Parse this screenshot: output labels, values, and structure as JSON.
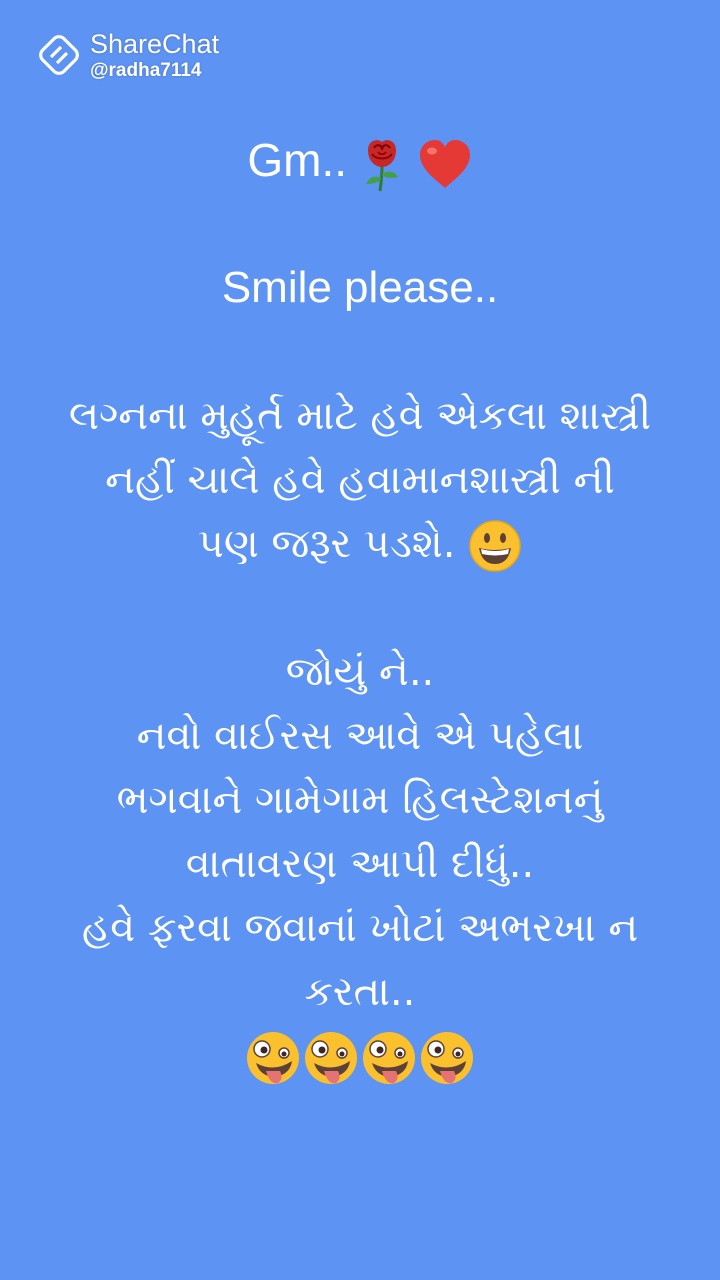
{
  "watermark": {
    "brand": "ShareChat",
    "handle": "@radha7114"
  },
  "post": {
    "greeting": "Gm..",
    "greeting_icons": [
      "rose-icon",
      "heart-icon"
    ],
    "smile": "Smile please..",
    "para1": [
      "લગ્નના મુહૂર્ત માટે હવે એકલા શાસ્ત્રી",
      "નહીં ચાલે હવે હવામાનશાસ્ત્રી ની",
      "પણ જરૂર પડશે."
    ],
    "para1_icon": "grinning-face-icon",
    "para2": [
      "જોયું ને..",
      "નવો વાઈરસ આવે એ પહેલા",
      "ભગવાને ગામેગામ હિલસ્ટેશનનું",
      "વાતાવરણ આપી દીધું..",
      "હવે ફરવા જવાનાં ખોટાં અભરખા ન",
      "કરતા.."
    ],
    "para2_icons": [
      "zany-face-icon",
      "zany-face-icon",
      "zany-face-icon",
      "zany-face-icon"
    ]
  },
  "colors": {
    "background": "#5d93f3",
    "text": "#ffffff"
  }
}
